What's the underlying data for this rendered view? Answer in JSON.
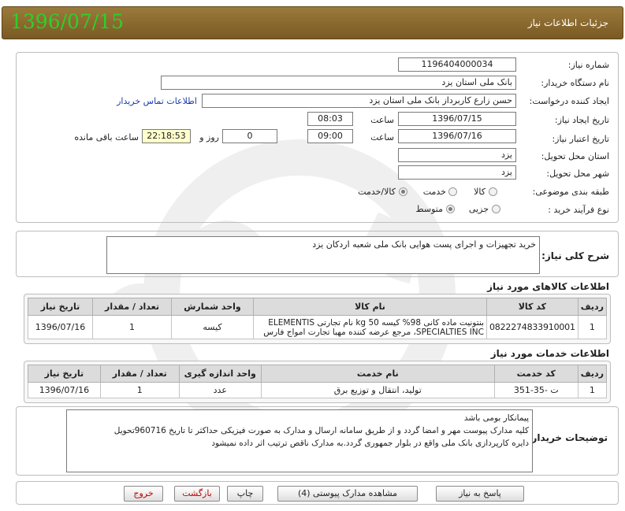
{
  "header": {
    "title": "جزئیات اطلاعات نیاز",
    "date": "1396/07/15"
  },
  "form": {
    "need_number_label": "شماره نیاز:",
    "need_number": "1196404000034",
    "buyer_org_label": "نام دستگاه خریدار:",
    "buyer_org": "بانک ملی استان یزد",
    "requester_label": "ایجاد کننده درخواست:",
    "requester": "حسن زارع کاربرداز بانک ملی استان یزد",
    "contact_link": "اطلاعات تماس خریدار",
    "announce_date_label": "تاریخ ایجاد نیاز:",
    "announce_date": "1396/07/15",
    "time_label": "ساعت",
    "announce_time": "08:03",
    "validity_date_label": "تاریخ اعتبار نیاز:",
    "validity_date": "1396/07/16",
    "validity_time": "09:00",
    "days_value": "0",
    "days_label": "روز و",
    "remaining_time": "22:18:53",
    "remaining_label": "ساعت باقی مانده",
    "province_label": "استان محل تحویل:",
    "province": "یزد",
    "city_label": "شهر محل تحویل:",
    "city": "یزد",
    "category_label": "طبقه بندی موضوعی:",
    "category_options": [
      "کالا",
      "خدمت",
      "کالا/خدمت"
    ],
    "category_selected": "کالا/خدمت",
    "process_label": "نوع فرآیند خرید :",
    "process_options": [
      "جزیی",
      "متوسط"
    ],
    "process_selected": "متوسط"
  },
  "summary": {
    "label": "شرح کلی نیاز:",
    "text": "خرید تجهیزات و اجرای پست هوایی  بانک ملی شعبه اردکان یزد"
  },
  "goods": {
    "title": "اطلاعات کالاهای مورد نیاز",
    "headers": [
      "ردیف",
      "کد کالا",
      "نام کالا",
      "واحد شمارش",
      "تعداد / مقدار",
      "تاریخ نیاز"
    ],
    "rows": [
      {
        "row": "1",
        "code": "0822274833910001",
        "name_line1": "بنتونیت ماده کانی 98% کیسه 50 kg نام تجارتی ELEMENTIS",
        "name_line2": "SPECIALTIES INC، مرجع عرضه کننده مهبا تجارت امواج فارس",
        "unit": "کیسه",
        "qty": "1",
        "date": "1396/07/16"
      }
    ]
  },
  "services": {
    "title": "اطلاعات خدمات مورد نیاز",
    "headers": [
      "ردیف",
      "کد خدمت",
      "نام خدمت",
      "واحد اندازه گیری",
      "تعداد / مقدار",
      "تاریخ نیاز"
    ],
    "rows": [
      {
        "row": "1",
        "code": "ت -35-351",
        "name": "تولید، انتقال و توزیع برق",
        "unit": "عدد",
        "qty": "1",
        "date": "1396/07/16"
      }
    ]
  },
  "buyer_notes": {
    "label": "توضیحات خریدار:",
    "line1": "پیمانکار بومی باشد",
    "line2": "کلیه مدارک پیوست مهر و امضا گردد و از طریق سامانه ارسال و مدارک به صورت فیزیکی حداکثر تا تاریخ 960716تحویل",
    "line3": "دایره کارپردازی بانک ملی واقع در بلوار جمهوری گردد.به مدارک ناقص ترتیب اثر داده نمیشود"
  },
  "buttons": {
    "respond": "پاسخ به نیاز",
    "attachments": "مشاهده مدارک پیوستی (4)",
    "print": "چاپ",
    "back": "بازگشت",
    "exit": "خروج"
  },
  "colors": {
    "header_bg": "#8a6a30",
    "date_green": "#2bd12b",
    "link_blue": "#1a3ea8",
    "highlight_yellow": "#ffffcc"
  }
}
